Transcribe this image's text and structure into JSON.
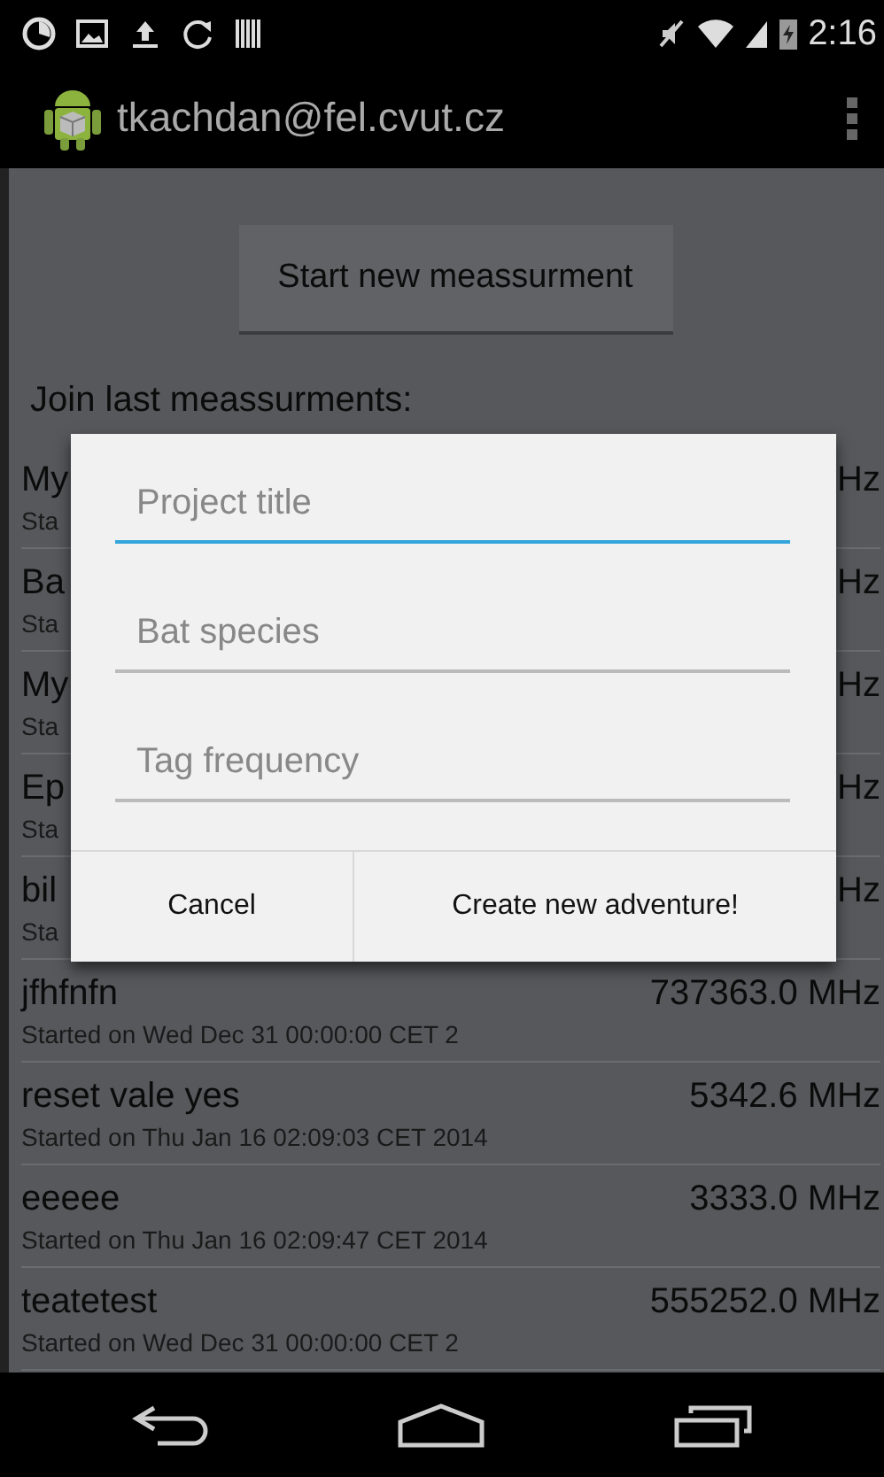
{
  "status_bar": {
    "time": "2:16"
  },
  "action_bar": {
    "title": "tkachdan@fel.cvut.cz"
  },
  "start_button": "Start new meassurment",
  "list_heading": "Join last meassurments:",
  "rows": [
    {
      "name": "My",
      "started": "Sta",
      "frequency": "Hz"
    },
    {
      "name": "Ba",
      "started": "Sta",
      "frequency": "Hz"
    },
    {
      "name": "My",
      "started": "Sta",
      "frequency": "Hz"
    },
    {
      "name": "Ep",
      "started": "Sta",
      "frequency": "Hz"
    },
    {
      "name": "bil",
      "started": "Sta",
      "frequency": "Hz"
    },
    {
      "name": "jfhfnfn",
      "started": "Started on Wed Dec 31 00:00:00 CET 2",
      "frequency": "737363.0 MHz"
    },
    {
      "name": "reset vale yes",
      "started": "Started on Thu Jan 16 02:09:03 CET 2014",
      "frequency": "5342.6 MHz"
    },
    {
      "name": "eeeee",
      "started": "Started on Thu Jan 16 02:09:47 CET 2014",
      "frequency": "3333.0 MHz"
    },
    {
      "name": "teatetest",
      "started": "Started on Wed Dec 31 00:00:00 CET 2",
      "frequency": "555252.0 MHz"
    }
  ],
  "dialog": {
    "fields": [
      {
        "placeholder": "Project title",
        "focused": true
      },
      {
        "placeholder": "Bat species",
        "focused": false
      },
      {
        "placeholder": "Tag frequency",
        "focused": false
      }
    ],
    "buttons": [
      "Cancel",
      "Create new adventure!"
    ]
  }
}
